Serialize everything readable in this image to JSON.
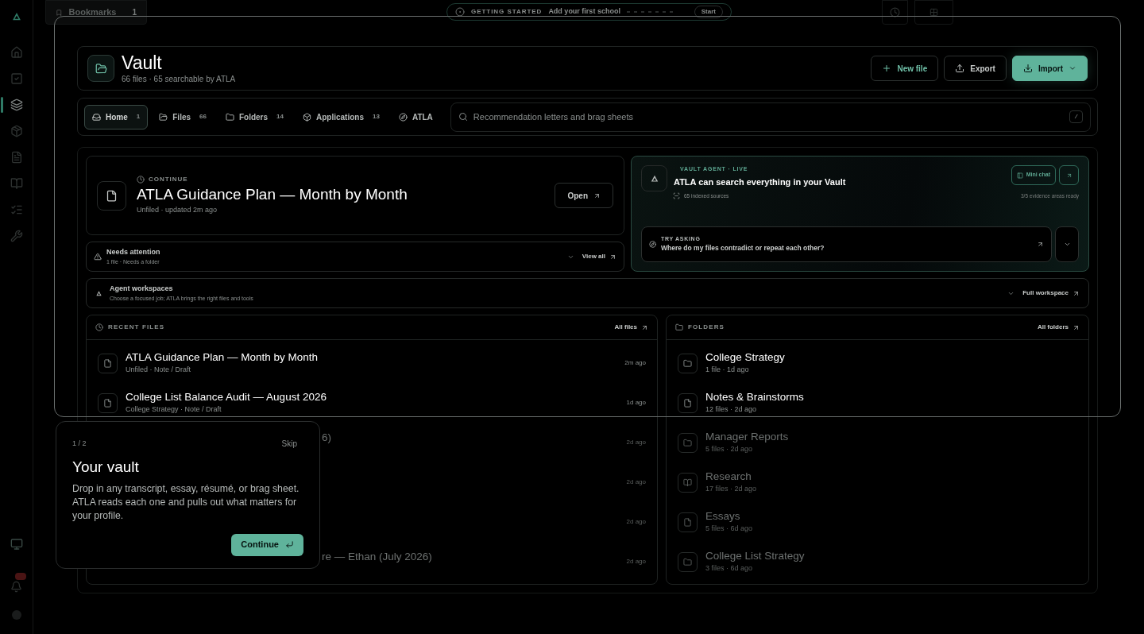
{
  "sidebar": {
    "items": [
      {
        "selected": false
      },
      {
        "selected": false
      },
      {
        "selected": true
      },
      {
        "selected": false
      },
      {
        "selected": false
      },
      {
        "selected": false
      },
      {
        "selected": false
      },
      {
        "selected": false
      }
    ]
  },
  "topbar": {
    "bookmarks": {
      "label": "Bookmarks",
      "count": "1"
    },
    "getting_started": {
      "tag": "GETTING STARTED",
      "text": "Add your first school",
      "action": "Start"
    }
  },
  "header": {
    "title": "Vault",
    "subtitle": "66 files · 65 searchable by ATLA",
    "buttons": [
      {
        "label": "New file",
        "kind": "new"
      },
      {
        "label": "Export",
        "kind": "export"
      },
      {
        "label": "Import",
        "kind": "import"
      }
    ]
  },
  "tabs": [
    {
      "label": "Home",
      "count": "1",
      "selected": true,
      "kind": "home"
    },
    {
      "label": "Files",
      "count": "66",
      "selected": false,
      "kind": "files"
    },
    {
      "label": "Folders",
      "count": "14",
      "selected": false,
      "kind": "folders"
    },
    {
      "label": "Applications",
      "count": "13",
      "selected": false,
      "kind": "applications"
    },
    {
      "label": "ATLA",
      "selected": false,
      "kind": "atla"
    }
  ],
  "search": {
    "placeholder": "Recommendation letters and brag sheets",
    "shortcut": "/"
  },
  "continue": {
    "tag": "CONTINUE",
    "title": "ATLA Guidance Plan — Month by Month",
    "meta": "Unfiled · updated 2m ago",
    "action": "Open"
  },
  "attention": {
    "title": "Needs attention",
    "meta": "1 file · Needs a folder",
    "action": "View all"
  },
  "agent": {
    "tag": "VAULT AGENT · LIVE",
    "title": "ATLA can search everything in your Vault",
    "chat": "Mini chat",
    "sources": "65 indexed sources",
    "readiness": "3/5 evidence areas ready",
    "prompt": {
      "tag": "TRY ASKING",
      "text": "Where do my files contradict or repeat each other?"
    }
  },
  "workspaces": {
    "title": "Agent workspaces",
    "meta": "Choose a focused job; ATLA brings the right files and tools",
    "action": "Full workspace"
  },
  "recent_files": {
    "title": "RECENT FILES",
    "action": "All files",
    "rows": [
      {
        "kind": "file",
        "title": "ATLA Guidance Plan — Month by Month",
        "meta": "Unfiled · Note / Draft",
        "time": "2m ago",
        "dimmed": false
      },
      {
        "kind": "file",
        "title": "College List Balance Audit — August 2026",
        "meta": "College Strategy · Note / Draft",
        "time": "1d ago",
        "dimmed": false
      },
      {
        "kind": "covered",
        "title": "6)",
        "time": "2d ago",
        "dimmed": true
      },
      {
        "kind": "covered",
        "time": "2d ago",
        "dimmed": true
      },
      {
        "kind": "covered",
        "time": "2d ago",
        "dimmed": true
      },
      {
        "kind": "covered",
        "title": "re — Ethan (July 2026)",
        "time": "2d ago",
        "dimmed": true
      }
    ]
  },
  "folders": {
    "title": "FOLDERS",
    "action": "All folders",
    "rows": [
      {
        "kind": "folder",
        "name": "College Strategy",
        "meta": "1 file · 1d ago",
        "dimmed": false
      },
      {
        "kind": "document",
        "name": "Notes & Brainstorms",
        "meta": "12 files · 2d ago",
        "dimmed": false
      },
      {
        "kind": "folder",
        "name": "Manager Reports",
        "meta": "5 files · 2d ago",
        "dimmed": true
      },
      {
        "kind": "book",
        "name": "Research",
        "meta": "17 files · 2d ago",
        "dimmed": true
      },
      {
        "kind": "document",
        "name": "Essays",
        "meta": "5 files · 6d ago",
        "dimmed": true
      },
      {
        "kind": "folder",
        "name": "College List Strategy",
        "meta": "3 files · 6d ago",
        "dimmed": true
      }
    ]
  },
  "tour": {
    "step": "1 / 2",
    "skip": "Skip",
    "title": "Your vault",
    "body": "Drop in any transcript, essay, résumé, or brag sheet. ATLA reads each one and pulls out what matters for your profile.",
    "action": "Continue"
  }
}
